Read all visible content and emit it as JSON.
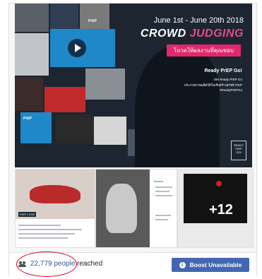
{
  "hero": {
    "date": "June 1st - June 20th 2018",
    "title_part1": "CROWD",
    "title_part2": "JUDGING",
    "subtitle": "โหวตให้ผลงานที่คุณชอบ",
    "ready": "Ready PrEP Go!",
    "ready_lines": [
      "เพจ Ready PrEP Go",
      "ประกวดภาพผลิตวิดีโอเชิงสร้างสรรค์ PrEP",
      "#ReadyPrEPGo"
    ],
    "corner_logo": [
      "READY",
      "PrEP",
      "GO!"
    ],
    "badges": [
      "PrEP",
      "PrEP"
    ]
  },
  "thumbnails": [
    {
      "label": "PrEP LOVE",
      "overlay": ""
    },
    {
      "label": "",
      "side_title": "Sexers",
      "overlay": ""
    },
    {
      "label": "",
      "overlay": "+12"
    }
  ],
  "footer": {
    "reach_count": "22,779 people",
    "reach_word": "reached",
    "boost_label": "Boost Unavailable",
    "icon": "people-icon"
  },
  "colors": {
    "accent": "#e0286d",
    "button": "#4267b2",
    "link": "#365899",
    "annotation": "#d0021b"
  }
}
